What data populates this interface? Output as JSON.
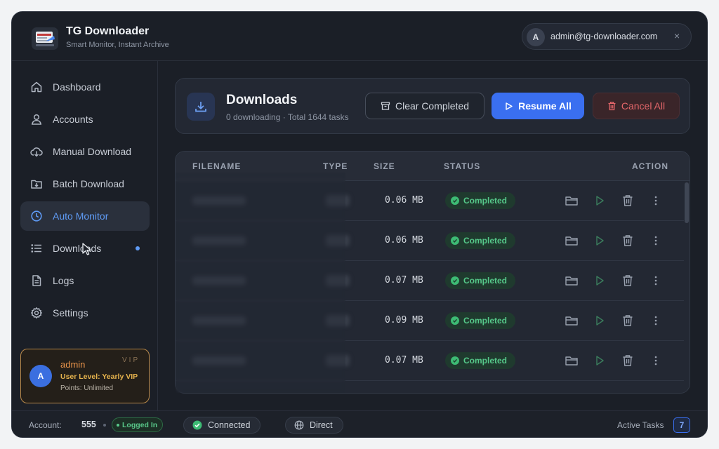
{
  "app": {
    "title": "TG Downloader",
    "subtitle": "Smart Monitor, Instant Archive"
  },
  "user": {
    "initial": "A",
    "email": "admin@tg-downloader.com",
    "close_glyph": "×"
  },
  "sidebar": {
    "items": [
      {
        "label": "Dashboard",
        "icon": "home-icon"
      },
      {
        "label": "Accounts",
        "icon": "user-icon"
      },
      {
        "label": "Manual Download",
        "icon": "cloud-download-icon"
      },
      {
        "label": "Batch Download",
        "icon": "folder-download-icon"
      },
      {
        "label": "Auto Monitor",
        "icon": "clock-icon",
        "active": true
      },
      {
        "label": "Downloads",
        "icon": "list-icon",
        "has_dot": true
      },
      {
        "label": "Logs",
        "icon": "file-icon"
      },
      {
        "label": "Settings",
        "icon": "gear-icon"
      }
    ],
    "vip": {
      "initial": "A",
      "name": "admin",
      "tag": "VIP",
      "level": "User Level: Yearly VIP",
      "points": "Points: Unlimited"
    }
  },
  "downloads": {
    "title": "Downloads",
    "subtitle": "0 downloading · Total 1644 tasks",
    "clear_label": "Clear Completed",
    "resume_label": "Resume All",
    "cancel_label": "Cancel All"
  },
  "table": {
    "columns": [
      "FILENAME",
      "TYPE",
      "SIZE",
      "STATUS",
      "ACTION"
    ],
    "rows": [
      {
        "size": "0.06 MB",
        "status": "Completed"
      },
      {
        "size": "0.06 MB",
        "status": "Completed"
      },
      {
        "size": "0.07 MB",
        "status": "Completed"
      },
      {
        "size": "0.09 MB",
        "status": "Completed"
      },
      {
        "size": "0.07 MB",
        "status": "Completed"
      }
    ]
  },
  "statusbar": {
    "account_label": "Account:",
    "account_count": "555",
    "login_status": "Logged In",
    "connection": "Connected",
    "mode": "Direct",
    "active_tasks_label": "Active Tasks",
    "active_tasks_count": "7"
  },
  "colors": {
    "accent": "#3a6ff0",
    "success": "#3dbb74",
    "danger": "#e4666a",
    "vip": "#e6b34d"
  }
}
